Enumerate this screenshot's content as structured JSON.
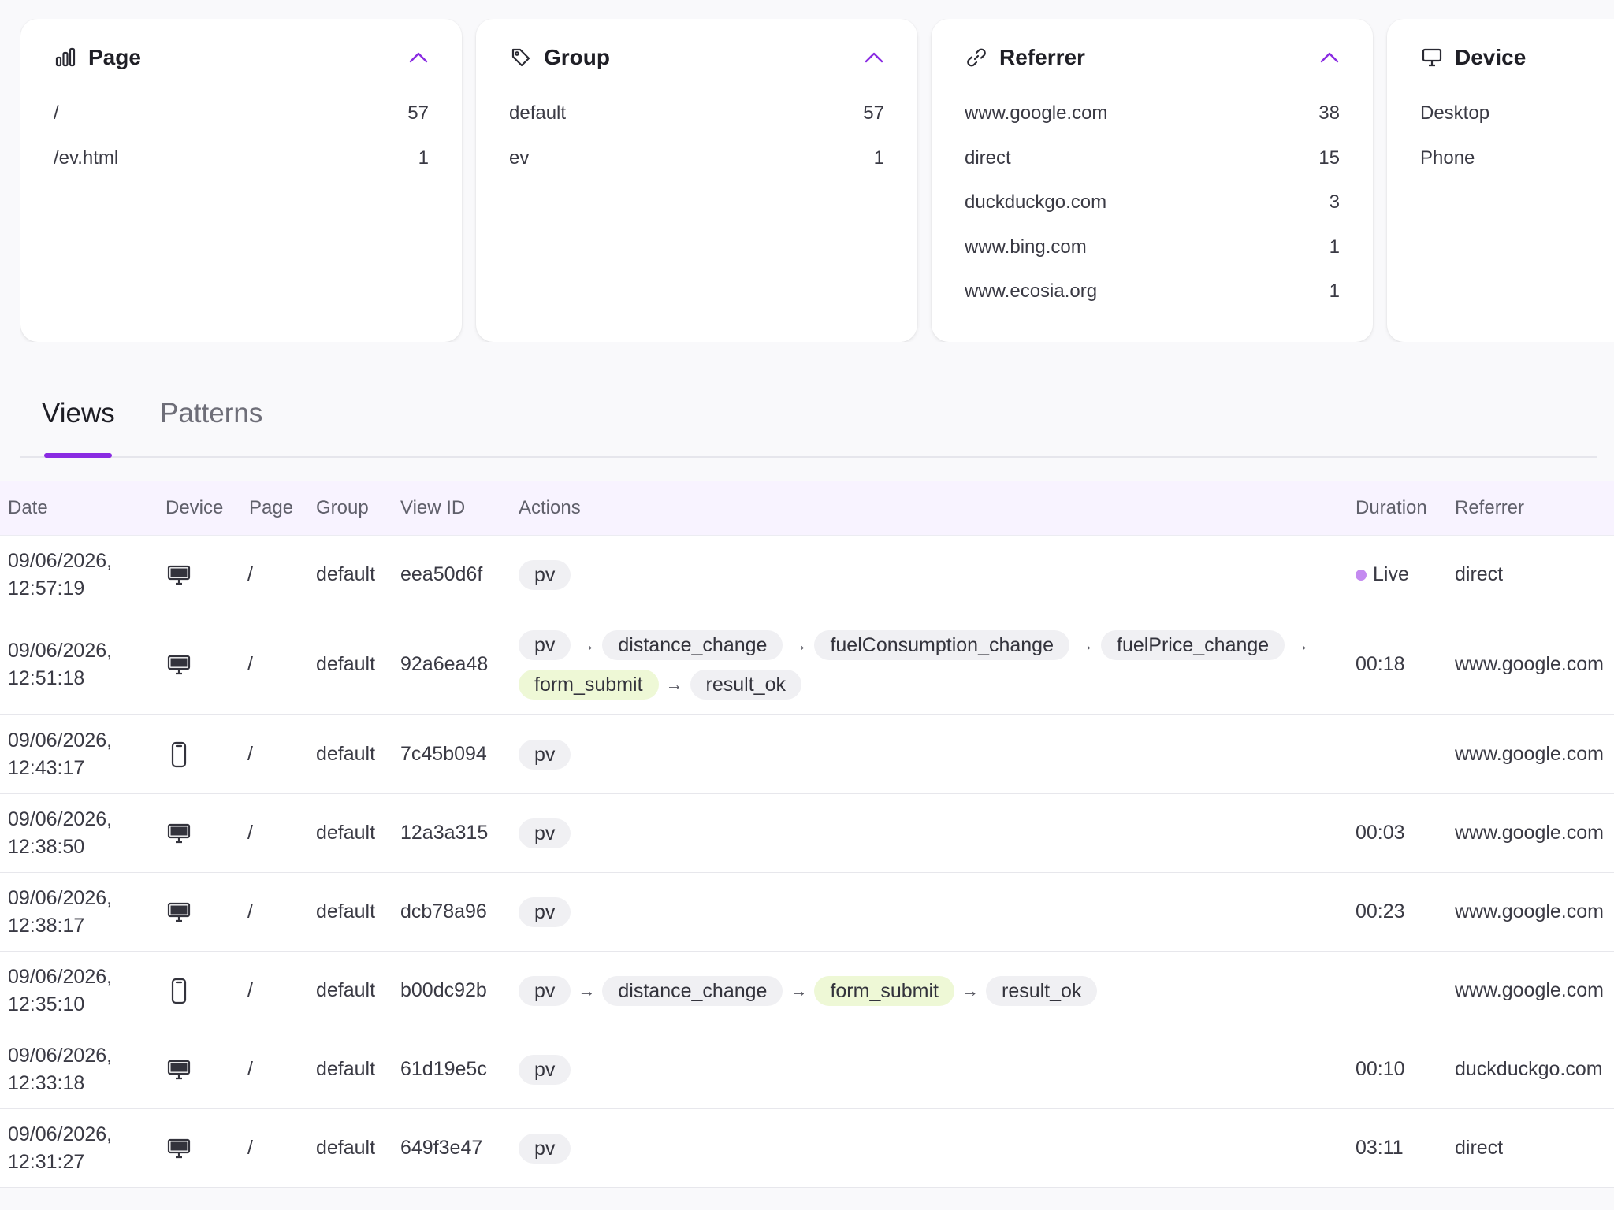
{
  "cards": [
    {
      "title": "Page",
      "icon": "bar-chart-icon",
      "items": [
        {
          "label": "/",
          "value": "57"
        },
        {
          "label": "/ev.html",
          "value": "1"
        }
      ]
    },
    {
      "title": "Group",
      "icon": "tag-icon",
      "items": [
        {
          "label": "default",
          "value": "57"
        },
        {
          "label": "ev",
          "value": "1"
        }
      ]
    },
    {
      "title": "Referrer",
      "icon": "link-icon",
      "items": [
        {
          "label": "www.google.com",
          "value": "38"
        },
        {
          "label": "direct",
          "value": "15"
        },
        {
          "label": "duckduckgo.com",
          "value": "3"
        },
        {
          "label": "www.bing.com",
          "value": "1"
        },
        {
          "label": "www.ecosia.org",
          "value": "1"
        }
      ]
    },
    {
      "title": "Device",
      "icon": "monitor-icon",
      "items": [
        {
          "label": "Desktop",
          "value": ""
        },
        {
          "label": "Phone",
          "value": ""
        }
      ]
    }
  ],
  "tabs": {
    "views": "Views",
    "patterns": "Patterns"
  },
  "colors": {
    "accent": "#8a2be2",
    "chip_green": "#eef8d6",
    "chip_gray": "#f0f0f3",
    "live": "#c48af0"
  },
  "table": {
    "headers": {
      "date": "Date",
      "device": "Device",
      "page": "Page",
      "group": "Group",
      "view_id": "View ID",
      "actions": "Actions",
      "duration": "Duration",
      "referrer": "Referrer"
    },
    "rows": [
      {
        "date1": "09/06/2026,",
        "date2": "12:57:19",
        "device": "desktop-icon",
        "page": "/",
        "group": "default",
        "view_id": "eea50d6f",
        "actions": [
          {
            "label": "pv",
            "highlight": false
          }
        ],
        "duration": "Live",
        "live": true,
        "referrer": "direct"
      },
      {
        "date1": "09/06/2026,",
        "date2": "12:51:18",
        "device": "desktop-icon",
        "page": "/",
        "group": "default",
        "view_id": "92a6ea48",
        "actions": [
          {
            "label": "pv",
            "highlight": false
          },
          {
            "label": "distance_change",
            "highlight": false
          },
          {
            "label": "fuelConsumption_change",
            "highlight": false
          },
          {
            "label": "fuelPrice_change",
            "highlight": false
          },
          {
            "label": "form_submit",
            "highlight": true
          },
          {
            "label": "result_ok",
            "highlight": false
          }
        ],
        "duration": "00:18",
        "live": false,
        "referrer": "www.google.com"
      },
      {
        "date1": "09/06/2026,",
        "date2": "12:43:17",
        "device": "phone-icon",
        "page": "/",
        "group": "default",
        "view_id": "7c45b094",
        "actions": [
          {
            "label": "pv",
            "highlight": false
          }
        ],
        "duration": "",
        "live": false,
        "referrer": "www.google.com"
      },
      {
        "date1": "09/06/2026,",
        "date2": "12:38:50",
        "device": "desktop-icon",
        "page": "/",
        "group": "default",
        "view_id": "12a3a315",
        "actions": [
          {
            "label": "pv",
            "highlight": false
          }
        ],
        "duration": "00:03",
        "live": false,
        "referrer": "www.google.com"
      },
      {
        "date1": "09/06/2026,",
        "date2": "12:38:17",
        "device": "desktop-icon",
        "page": "/",
        "group": "default",
        "view_id": "dcb78a96",
        "actions": [
          {
            "label": "pv",
            "highlight": false
          }
        ],
        "duration": "00:23",
        "live": false,
        "referrer": "www.google.com"
      },
      {
        "date1": "09/06/2026,",
        "date2": "12:35:10",
        "device": "phone-icon",
        "page": "/",
        "group": "default",
        "view_id": "b00dc92b",
        "actions": [
          {
            "label": "pv",
            "highlight": false
          },
          {
            "label": "distance_change",
            "highlight": false
          },
          {
            "label": "form_submit",
            "highlight": true
          },
          {
            "label": "result_ok",
            "highlight": false
          }
        ],
        "duration": "",
        "live": false,
        "referrer": "www.google.com"
      },
      {
        "date1": "09/06/2026,",
        "date2": "12:33:18",
        "device": "desktop-icon",
        "page": "/",
        "group": "default",
        "view_id": "61d19e5c",
        "actions": [
          {
            "label": "pv",
            "highlight": false
          }
        ],
        "duration": "00:10",
        "live": false,
        "referrer": "duckduckgo.com"
      },
      {
        "date1": "09/06/2026,",
        "date2": "12:31:27",
        "device": "desktop-icon",
        "page": "/",
        "group": "default",
        "view_id": "649f3e47",
        "actions": [
          {
            "label": "pv",
            "highlight": false
          }
        ],
        "duration": "03:11",
        "live": false,
        "referrer": "direct"
      }
    ]
  }
}
